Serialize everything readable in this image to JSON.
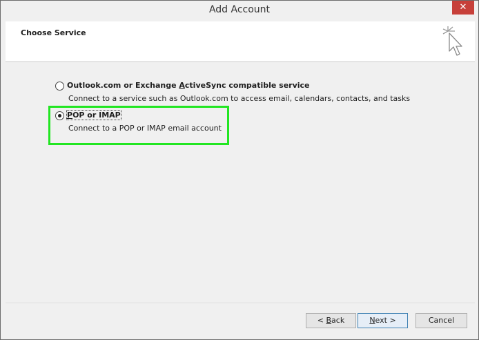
{
  "window": {
    "title": "Add Account",
    "close_glyph": "✕"
  },
  "header": {
    "title": "Choose Service",
    "icon": "cursor-click-icon"
  },
  "options": [
    {
      "label_pre": "Outlook.com or Exchange ",
      "label_accel": "A",
      "label_post": "ctiveSync compatible service",
      "description": "Connect to a service such as Outlook.com to access email, calendars, contacts, and tasks",
      "selected": false
    },
    {
      "label_pre": "",
      "label_accel": "P",
      "label_post": "OP or IMAP",
      "description": "Connect to a POP or IMAP email account",
      "selected": true
    }
  ],
  "buttons": {
    "back_pre": "< ",
    "back_accel": "B",
    "back_post": "ack",
    "next_accel": "N",
    "next_post": "ext >",
    "cancel": "Cancel"
  },
  "colors": {
    "highlight": "#22e622",
    "close_button": "#c7403a"
  }
}
